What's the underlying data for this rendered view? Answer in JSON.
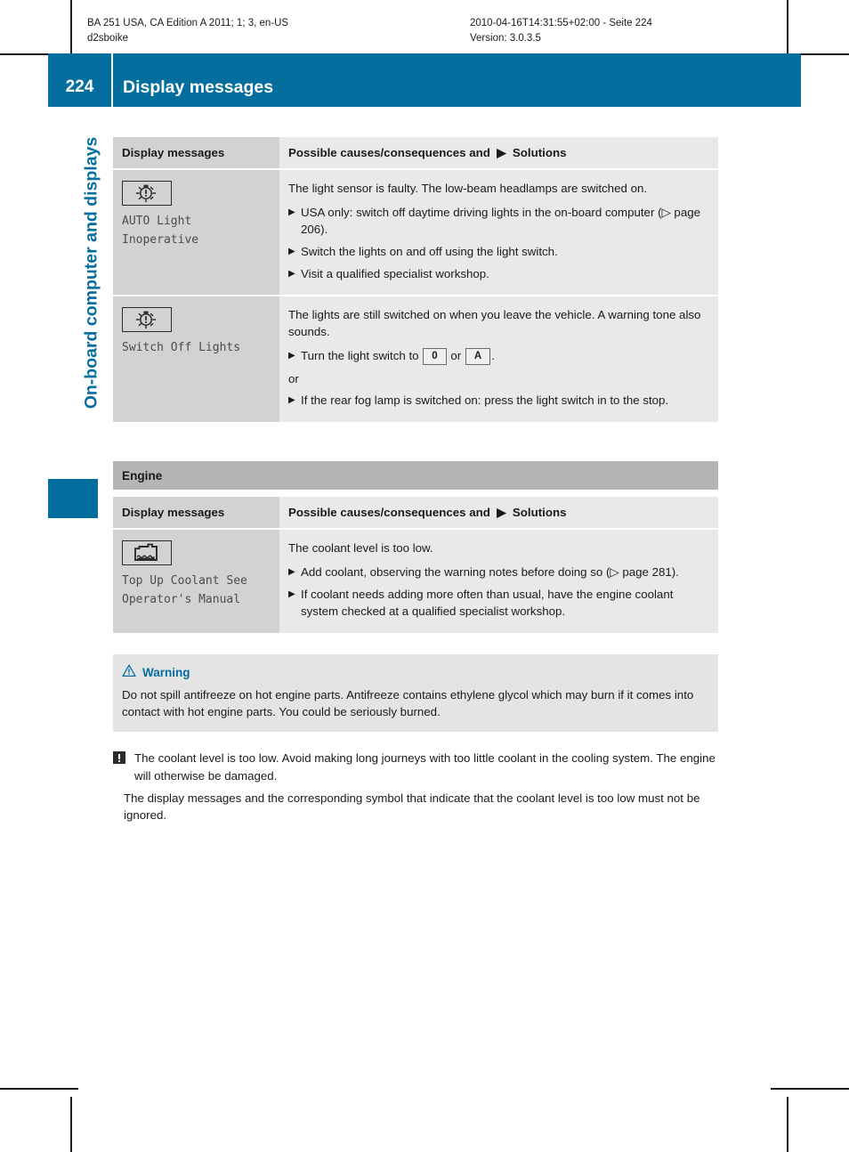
{
  "print_header": {
    "left_line1": "BA 251 USA, CA Edition A 2011; 1; 3, en-US",
    "left_line2": "d2sboike",
    "right_line1": "2010-04-16T14:31:55+02:00 - Seite 224",
    "right_line2": "Version: 3.0.3.5"
  },
  "header": {
    "page_number": "224",
    "title": "Display messages",
    "accent_color": "#046e9e"
  },
  "chapter_tab": {
    "label": "On-board computer and displays"
  },
  "table_headers": {
    "col1": "Display messages",
    "col2_pre": "Possible causes/consequences and",
    "col2_post": "Solutions"
  },
  "lights_table": {
    "rows": [
      {
        "symbol": "light-sensor-warning-icon",
        "message": "AUTO Light\nInoperative",
        "intro": "The light sensor is faulty. The low-beam headlamps are switched on.",
        "bullets": [
          "USA only: switch off daytime driving lights in the on-board computer (▷ page 206).",
          "Switch the lights on and off using the light switch.",
          "Visit a qualified specialist workshop."
        ]
      },
      {
        "symbol": "light-sensor-warning-icon",
        "message": "Switch Off Lights",
        "intro": "The lights are still switched on when you leave the vehicle. A warning tone also sounds.",
        "bullet_keycap_pre": "Turn the light switch to",
        "keycap_0": "0",
        "keycap_or": "or",
        "keycap_a": "A",
        "keycap_post": ".",
        "or_label": "or",
        "bullets_after": [
          "If the rear fog lamp is switched on: press the light switch in to the stop."
        ]
      }
    ]
  },
  "engine_section": {
    "title": "Engine",
    "rows": [
      {
        "symbol": "coolant-level-icon",
        "message": "Top Up Coolant See\nOperator's Manual",
        "intro": "The coolant level is too low.",
        "bullets": [
          "Add coolant, observing the warning notes before doing so (▷ page 281).",
          "If coolant needs adding more often than usual, have the engine coolant system checked at a qualified specialist workshop."
        ]
      }
    ]
  },
  "warning": {
    "icon": "warning-triangle-icon",
    "title": "Warning",
    "body": "Do not spill antifreeze on hot engine parts. Antifreeze contains ethylene glycol which may burn if it comes into contact with hot engine parts. You could be seriously burned."
  },
  "note": {
    "icon": "exclamation-note-icon",
    "paragraph1": "The coolant level is too low. Avoid making long journeys with too little coolant in the cooling system. The engine will otherwise be damaged.",
    "paragraph2": "The display messages and the corresponding symbol that indicate that the coolant level is too low must not be ignored."
  }
}
